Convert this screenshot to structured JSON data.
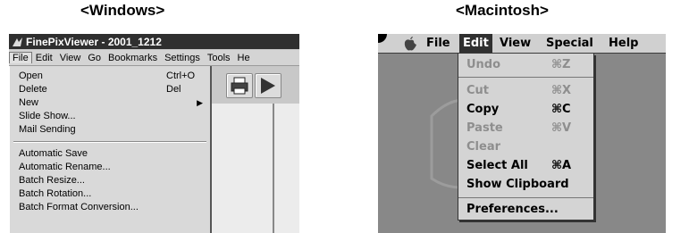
{
  "headings": {
    "windows": "<Windows>",
    "mac": "<Macintosh>"
  },
  "windows": {
    "title": "FinePixViewer - 2001_1212",
    "menubar": [
      "File",
      "Edit",
      "View",
      "Go",
      "Bookmarks",
      "Settings",
      "Tools",
      "He"
    ],
    "file_menu": [
      {
        "label": "Open",
        "shortcut": "Ctrl+O"
      },
      {
        "label": "Delete",
        "shortcut": "Del"
      },
      {
        "label": "New",
        "submenu": true
      },
      {
        "label": "Slide Show..."
      },
      {
        "label": "Mail Sending"
      },
      {
        "separator": true
      },
      {
        "label": "Automatic Save"
      },
      {
        "label": "Automatic Rename..."
      },
      {
        "label": "Batch Resize..."
      },
      {
        "label": "Batch Rotation..."
      },
      {
        "label": "Batch Format Conversion..."
      }
    ]
  },
  "mac": {
    "menubar": [
      "File",
      "Edit",
      "View",
      "Special",
      "Help"
    ],
    "edit_menu": [
      {
        "label": "Undo",
        "shortcut": "⌘Z",
        "disabled": true
      },
      {
        "separator": true
      },
      {
        "label": "Cut",
        "shortcut": "⌘X",
        "disabled": true
      },
      {
        "label": "Copy",
        "shortcut": "⌘C",
        "disabled": false
      },
      {
        "label": "Paste",
        "shortcut": "⌘V",
        "disabled": true
      },
      {
        "label": "Clear",
        "disabled": true
      },
      {
        "label": "Select All",
        "shortcut": "⌘A",
        "disabled": false
      },
      {
        "label": "Show Clipboard",
        "disabled": false
      },
      {
        "separator": true
      },
      {
        "label": "Preferences...",
        "disabled": false
      }
    ]
  }
}
